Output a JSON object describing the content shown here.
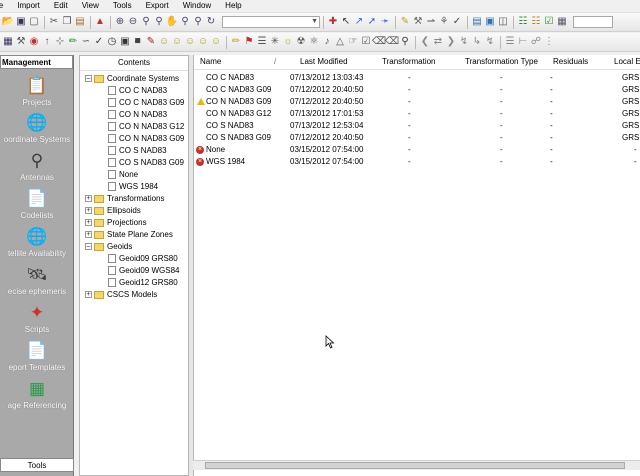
{
  "menubar": {
    "items": [
      "le",
      "Import",
      "Edit",
      "View",
      "Tools",
      "Export",
      "Window",
      "Help"
    ]
  },
  "sidebar": {
    "header": "Management",
    "items": [
      {
        "label": "Projects"
      },
      {
        "label": "oordinate Systems"
      },
      {
        "label": "Antennas"
      },
      {
        "label": "Codelists"
      },
      {
        "label": "tellite Availability"
      },
      {
        "label": "ecise ephemeris"
      },
      {
        "label": "Scripts"
      },
      {
        "label": "eport Templates"
      },
      {
        "label": "age Referencing"
      }
    ],
    "tools_label": "Tools"
  },
  "tree": {
    "header": "Contents",
    "nodes": [
      {
        "label": "Coordinate Systems"
      },
      {
        "label": "CO C NAD83"
      },
      {
        "label": "CO C NAD83 G09"
      },
      {
        "label": "CO N NAD83"
      },
      {
        "label": "CO N NAD83 G12"
      },
      {
        "label": "CO N NAD83 G09"
      },
      {
        "label": "CO S NAD83"
      },
      {
        "label": "CO S NAD83 G09"
      },
      {
        "label": "None"
      },
      {
        "label": "WGS 1984"
      },
      {
        "label": "Transformations"
      },
      {
        "label": "Ellipsoids"
      },
      {
        "label": "Projections"
      },
      {
        "label": "State Plane Zones"
      },
      {
        "label": "Geoids"
      },
      {
        "label": "Geoid09 GRS80"
      },
      {
        "label": "Geoid09 WGS84"
      },
      {
        "label": "Geoid12 GRS80"
      },
      {
        "label": "CSCS Models"
      }
    ]
  },
  "list": {
    "columns": [
      "Name",
      "/",
      "Last Modified",
      "Transformation",
      "Transformation Type",
      "Residuals",
      "Local El"
    ],
    "rows": [
      {
        "name": "CO C NAD83",
        "modified": "07/13/2012 13:03:43",
        "transformation": "-",
        "type": "-",
        "residuals": "-",
        "local": "GRS 1"
      },
      {
        "name": "CO C NAD83 G09",
        "modified": "07/12/2012 20:40:50",
        "transformation": "-",
        "type": "-",
        "residuals": "-",
        "local": "GRS 1"
      },
      {
        "name": "CO N NAD83 G09",
        "modified": "07/12/2012 20:40:50",
        "transformation": "-",
        "type": "-",
        "residuals": "-",
        "local": "GRS 1"
      },
      {
        "name": "CO N NAD83 G12",
        "modified": "07/13/2012 17:01:53",
        "transformation": "-",
        "type": "-",
        "residuals": "-",
        "local": "GRS 1"
      },
      {
        "name": "CO S NAD83",
        "modified": "07/13/2012 12:53:04",
        "transformation": "-",
        "type": "-",
        "residuals": "-",
        "local": "GRS 1"
      },
      {
        "name": "CO S NAD83 G09",
        "modified": "07/12/2012 20:40:50",
        "transformation": "-",
        "type": "-",
        "residuals": "-",
        "local": "GRS 1"
      },
      {
        "name": "None",
        "modified": "03/15/2012 07:54:00",
        "transformation": "-",
        "type": "-",
        "residuals": "-",
        "local": "-"
      },
      {
        "name": "WGS 1984",
        "modified": "03/15/2012 07:54:00",
        "transformation": "-",
        "type": "-",
        "residuals": "-",
        "local": "-"
      }
    ]
  },
  "colors": {
    "sidebar_bg": "#a9a9a9",
    "warning": "#e8b70f",
    "error": "#c0332b",
    "folder": "#f4d66b"
  }
}
